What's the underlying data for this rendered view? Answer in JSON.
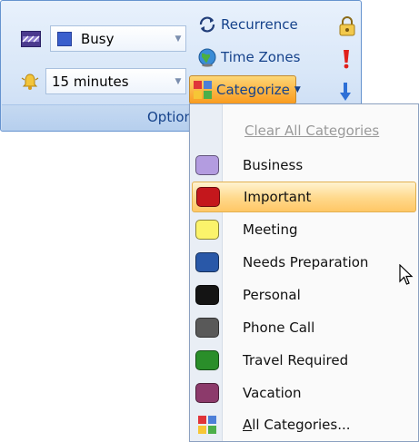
{
  "group": {
    "label": "Option"
  },
  "show_as": {
    "value": "Busy"
  },
  "reminder": {
    "value": "15 minutes"
  },
  "buttons": {
    "recurrence": "Recurrence",
    "time_zones": "Time Zones",
    "categorize": "Categorize"
  },
  "menu": {
    "clear": "Clear All Categories",
    "items": [
      {
        "label": "Business",
        "color": "#b39ce0"
      },
      {
        "label": "Important",
        "color": "#c4171c"
      },
      {
        "label": "Meeting",
        "color": "#fbf36b"
      },
      {
        "label": "Needs Preparation",
        "color": "#2958a8"
      },
      {
        "label": "Personal",
        "color": "#141414"
      },
      {
        "label": "Phone Call",
        "color": "#595959"
      },
      {
        "label": "Travel Required",
        "color": "#2a8e2a"
      },
      {
        "label": "Vacation",
        "color": "#8c3a6b"
      }
    ],
    "all_prefix": "A",
    "all_rest": "ll Categories...",
    "highlighted_index": 1
  },
  "icons": {
    "show_as": "show-as-icon",
    "reminder": "bell-icon",
    "recurrence": "recurrence-icon",
    "time_zones": "globe-icon",
    "categorize": "categorize-icon",
    "private": "lock-icon",
    "high_importance": "exclamation-icon",
    "low_importance": "down-arrow-icon"
  }
}
